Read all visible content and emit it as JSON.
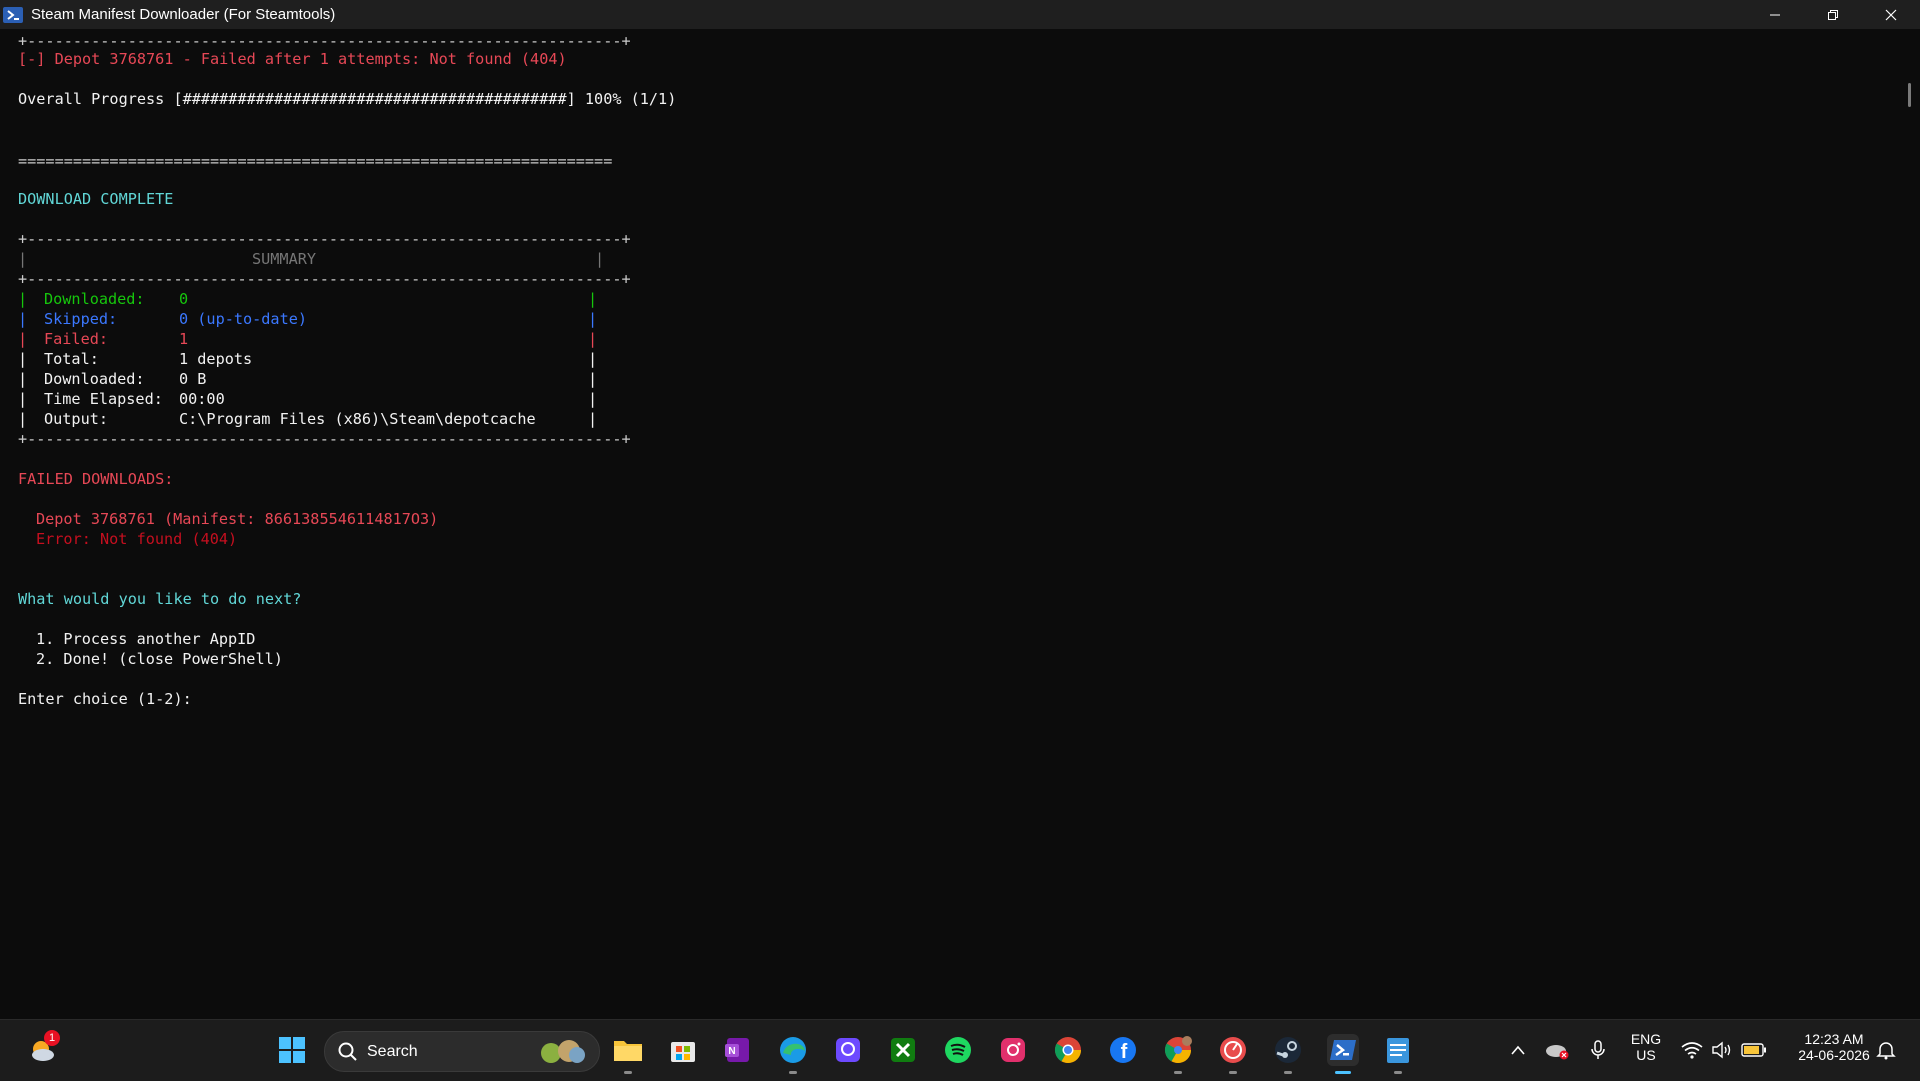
{
  "window": {
    "title": "Steam Manifest Downloader (For Steamtools)"
  },
  "terminal": {
    "sep_top": "+-----------------------------------------------------------------+",
    "depot_fail": "[-] Depot 3768761 - Failed after 1 attempts: Not found (404)",
    "overall_progress": "Overall Progress [##########################################] 100% (1/1)",
    "double_sep": "=================================================================",
    "download_complete": "DOWNLOAD COMPLETE",
    "summary_border": "+-----------------------------------------------------------------+",
    "summary_title": "SUMMARY",
    "summary": {
      "downloaded_label": "Downloaded:",
      "downloaded_value": "0",
      "skipped_label": "Skipped:",
      "skipped_value": "0 (up-to-date)",
      "failed_label": "Failed:",
      "failed_value": "1",
      "total_label": "Total:",
      "total_value": "1 depots",
      "bytes_label": "Downloaded:",
      "bytes_value": "0 B",
      "time_label": "Time Elapsed:",
      "time_value": "00:00",
      "output_label": "Output:",
      "output_value": "C:\\Program Files (x86)\\Steam\\depotcache"
    },
    "failed_header": "FAILED DOWNLOADS:",
    "failed_item": "Depot 3768761 (Manifest: 8661385546114817O3)",
    "failed_error": "Error: Not found (404)",
    "prompt_question": "What would you like to do next?",
    "option_1": "1. Process another AppID",
    "option_2": "2. Done! (close PowerShell)",
    "enter_choice": "Enter choice (1-2):"
  },
  "taskbar": {
    "search_label": "Search",
    "notification_count": "1",
    "language": "ENG",
    "region": "US",
    "time": "12:23 AM",
    "date": "24-06-2026",
    "pinned_apps": [
      "weather-widget",
      "start",
      "file-explorer",
      "microsoft-store",
      "onenote",
      "edge",
      "proton-pass",
      "xbox",
      "spotify",
      "instagram",
      "chrome",
      "facebook",
      "chrome-profile",
      "speedtest",
      "steam",
      "powershell",
      "notepad"
    ]
  },
  "colors": {
    "terminal_bg": "#0c0c0c",
    "red": "#e74856",
    "green": "#16c60c",
    "blue": "#3b78ff",
    "cyan": "#61d6d6"
  }
}
